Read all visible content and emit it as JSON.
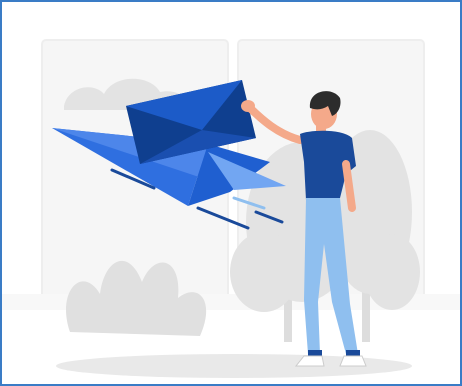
{
  "illustration": {
    "subject": "person-sending-envelope-on-paper-plane",
    "icons": [
      "envelope-icon",
      "paper-plane-icon",
      "person-figure",
      "plant-icon",
      "tree-icon",
      "window-frame"
    ],
    "colors": {
      "frame_border": "#3a7cc6",
      "envelope_dark": "#0f3f8f",
      "envelope_light": "#1c5bc8",
      "plane_primary": "#2f6fe0",
      "plane_light": "#72a6f2",
      "shirt": "#1a4a9a",
      "pants": "#8fbfef",
      "hair": "#2c2c2c",
      "skin": "#f4a98a",
      "shoes": "#ffffff",
      "background_shapes": "#e3e3e3",
      "window_fill": "#f6f6f6",
      "floor_shadow": "#e9e9e9"
    }
  }
}
